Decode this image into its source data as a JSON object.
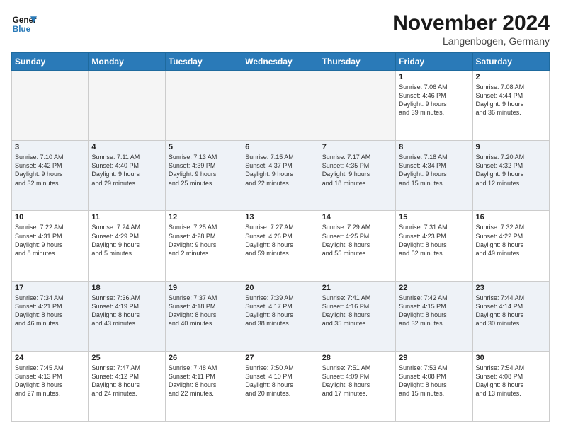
{
  "logo": {
    "line1": "General",
    "line2": "Blue"
  },
  "title": "November 2024",
  "location": "Langenbogen, Germany",
  "days_of_week": [
    "Sunday",
    "Monday",
    "Tuesday",
    "Wednesday",
    "Thursday",
    "Friday",
    "Saturday"
  ],
  "weeks": [
    [
      {
        "day": "",
        "info": ""
      },
      {
        "day": "",
        "info": ""
      },
      {
        "day": "",
        "info": ""
      },
      {
        "day": "",
        "info": ""
      },
      {
        "day": "",
        "info": ""
      },
      {
        "day": "1",
        "info": "Sunrise: 7:06 AM\nSunset: 4:46 PM\nDaylight: 9 hours\nand 39 minutes."
      },
      {
        "day": "2",
        "info": "Sunrise: 7:08 AM\nSunset: 4:44 PM\nDaylight: 9 hours\nand 36 minutes."
      }
    ],
    [
      {
        "day": "3",
        "info": "Sunrise: 7:10 AM\nSunset: 4:42 PM\nDaylight: 9 hours\nand 32 minutes."
      },
      {
        "day": "4",
        "info": "Sunrise: 7:11 AM\nSunset: 4:40 PM\nDaylight: 9 hours\nand 29 minutes."
      },
      {
        "day": "5",
        "info": "Sunrise: 7:13 AM\nSunset: 4:39 PM\nDaylight: 9 hours\nand 25 minutes."
      },
      {
        "day": "6",
        "info": "Sunrise: 7:15 AM\nSunset: 4:37 PM\nDaylight: 9 hours\nand 22 minutes."
      },
      {
        "day": "7",
        "info": "Sunrise: 7:17 AM\nSunset: 4:35 PM\nDaylight: 9 hours\nand 18 minutes."
      },
      {
        "day": "8",
        "info": "Sunrise: 7:18 AM\nSunset: 4:34 PM\nDaylight: 9 hours\nand 15 minutes."
      },
      {
        "day": "9",
        "info": "Sunrise: 7:20 AM\nSunset: 4:32 PM\nDaylight: 9 hours\nand 12 minutes."
      }
    ],
    [
      {
        "day": "10",
        "info": "Sunrise: 7:22 AM\nSunset: 4:31 PM\nDaylight: 9 hours\nand 8 minutes."
      },
      {
        "day": "11",
        "info": "Sunrise: 7:24 AM\nSunset: 4:29 PM\nDaylight: 9 hours\nand 5 minutes."
      },
      {
        "day": "12",
        "info": "Sunrise: 7:25 AM\nSunset: 4:28 PM\nDaylight: 9 hours\nand 2 minutes."
      },
      {
        "day": "13",
        "info": "Sunrise: 7:27 AM\nSunset: 4:26 PM\nDaylight: 8 hours\nand 59 minutes."
      },
      {
        "day": "14",
        "info": "Sunrise: 7:29 AM\nSunset: 4:25 PM\nDaylight: 8 hours\nand 55 minutes."
      },
      {
        "day": "15",
        "info": "Sunrise: 7:31 AM\nSunset: 4:23 PM\nDaylight: 8 hours\nand 52 minutes."
      },
      {
        "day": "16",
        "info": "Sunrise: 7:32 AM\nSunset: 4:22 PM\nDaylight: 8 hours\nand 49 minutes."
      }
    ],
    [
      {
        "day": "17",
        "info": "Sunrise: 7:34 AM\nSunset: 4:21 PM\nDaylight: 8 hours\nand 46 minutes."
      },
      {
        "day": "18",
        "info": "Sunrise: 7:36 AM\nSunset: 4:19 PM\nDaylight: 8 hours\nand 43 minutes."
      },
      {
        "day": "19",
        "info": "Sunrise: 7:37 AM\nSunset: 4:18 PM\nDaylight: 8 hours\nand 40 minutes."
      },
      {
        "day": "20",
        "info": "Sunrise: 7:39 AM\nSunset: 4:17 PM\nDaylight: 8 hours\nand 38 minutes."
      },
      {
        "day": "21",
        "info": "Sunrise: 7:41 AM\nSunset: 4:16 PM\nDaylight: 8 hours\nand 35 minutes."
      },
      {
        "day": "22",
        "info": "Sunrise: 7:42 AM\nSunset: 4:15 PM\nDaylight: 8 hours\nand 32 minutes."
      },
      {
        "day": "23",
        "info": "Sunrise: 7:44 AM\nSunset: 4:14 PM\nDaylight: 8 hours\nand 30 minutes."
      }
    ],
    [
      {
        "day": "24",
        "info": "Sunrise: 7:45 AM\nSunset: 4:13 PM\nDaylight: 8 hours\nand 27 minutes."
      },
      {
        "day": "25",
        "info": "Sunrise: 7:47 AM\nSunset: 4:12 PM\nDaylight: 8 hours\nand 24 minutes."
      },
      {
        "day": "26",
        "info": "Sunrise: 7:48 AM\nSunset: 4:11 PM\nDaylight: 8 hours\nand 22 minutes."
      },
      {
        "day": "27",
        "info": "Sunrise: 7:50 AM\nSunset: 4:10 PM\nDaylight: 8 hours\nand 20 minutes."
      },
      {
        "day": "28",
        "info": "Sunrise: 7:51 AM\nSunset: 4:09 PM\nDaylight: 8 hours\nand 17 minutes."
      },
      {
        "day": "29",
        "info": "Sunrise: 7:53 AM\nSunset: 4:08 PM\nDaylight: 8 hours\nand 15 minutes."
      },
      {
        "day": "30",
        "info": "Sunrise: 7:54 AM\nSunset: 4:08 PM\nDaylight: 8 hours\nand 13 minutes."
      }
    ]
  ]
}
